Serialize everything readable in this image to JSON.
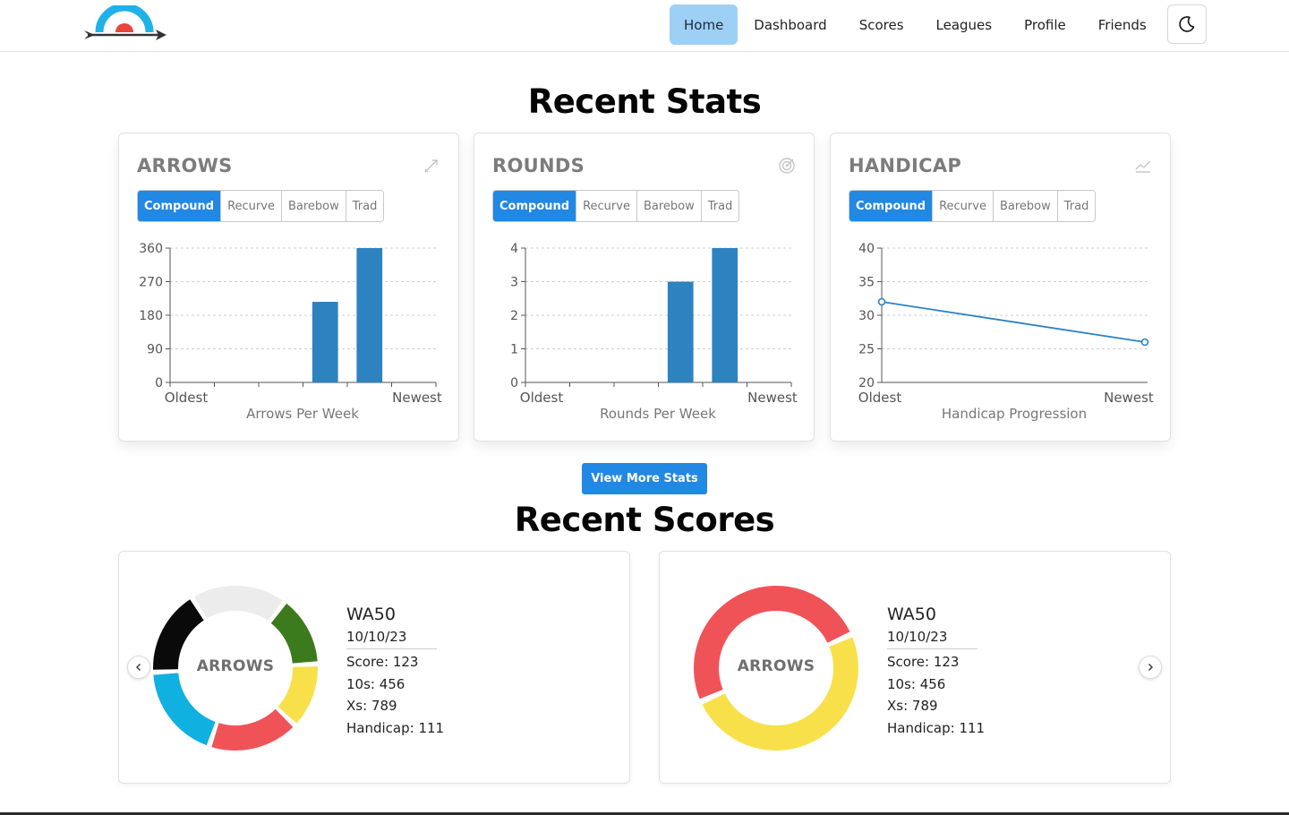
{
  "nav": {
    "items": [
      {
        "label": "Home",
        "active": true
      },
      {
        "label": "Dashboard"
      },
      {
        "label": "Scores"
      },
      {
        "label": "Leagues"
      },
      {
        "label": "Profile"
      },
      {
        "label": "Friends"
      }
    ],
    "theme_icon": "moon-icon",
    "logo_icon": "archery-target-arrow-logo"
  },
  "recent_stats": {
    "title": "Recent Stats",
    "tabs": [
      "Compound",
      "Recurve",
      "Barebow",
      "Trad"
    ],
    "active_tab": "Compound",
    "cards": [
      {
        "title": "ARROWS",
        "icon": "arrow-icon"
      },
      {
        "title": "ROUNDS",
        "icon": "target-icon"
      },
      {
        "title": "HANDICAP",
        "icon": "line-chart-icon"
      }
    ],
    "view_more_label": "View More Stats"
  },
  "chart_data": [
    {
      "type": "bar",
      "categories": [
        "",
        "",
        "",
        "Oldest",
        "Newest",
        ""
      ],
      "x_tick_labels": {
        "left": "Oldest",
        "right": "Newest"
      },
      "values": [
        0,
        0,
        0,
        216,
        360,
        0
      ],
      "xlabel": "Arrows Per Week",
      "ylabel": "",
      "yticks": [
        0,
        90,
        180,
        270,
        360
      ],
      "ylim": [
        0,
        360
      ],
      "grid": true,
      "color": "#2d82c0"
    },
    {
      "type": "bar",
      "categories": [
        "",
        "",
        "",
        "",
        "",
        ""
      ],
      "x_tick_labels": {
        "left": "Oldest",
        "right": "Newest"
      },
      "values": [
        0,
        0,
        0,
        3,
        4,
        0
      ],
      "xlabel": "Rounds Per Week",
      "ylabel": "",
      "yticks": [
        0,
        1,
        2,
        3,
        4
      ],
      "ylim": [
        0,
        4
      ],
      "grid": true,
      "color": "#2d82c0"
    },
    {
      "type": "line",
      "x": [
        "Oldest",
        "Newest"
      ],
      "x_tick_labels": {
        "left": "Oldest",
        "right": "Newest"
      },
      "values": [
        32,
        26
      ],
      "xlabel": "Handicap Progression",
      "ylabel": "",
      "yticks": [
        20,
        25,
        30,
        35,
        40
      ],
      "ylim": [
        20,
        40
      ],
      "grid": true,
      "color": "#2d82c0"
    }
  ],
  "recent_scores": {
    "title": "Recent Scores",
    "cards": [
      {
        "center_label": "ARROWS",
        "round": "WA50",
        "date": "10/10/23",
        "score": "Score: 123",
        "tens": "10s: 456",
        "xs": "Xs: 789",
        "handicap": "Handicap: 111",
        "segments": [
          {
            "color": "#ececec",
            "fraction": 0.19
          },
          {
            "color": "#3c7a1e",
            "fraction": 0.14
          },
          {
            "color": "#f8e04a",
            "fraction": 0.13
          },
          {
            "color": "#f05357",
            "fraction": 0.18
          },
          {
            "color": "#10b0e0",
            "fraction": 0.19
          },
          {
            "color": "#0a0a0a",
            "fraction": 0.17
          }
        ]
      },
      {
        "center_label": "ARROWS",
        "round": "WA50",
        "date": "10/10/23",
        "score": "Score: 123",
        "tens": "10s: 456",
        "xs": "Xs: 789",
        "handicap": "Handicap: 111",
        "segments": [
          {
            "color": "#f8e04a",
            "fraction": 0.5
          },
          {
            "color": "#f05357",
            "fraction": 0.5
          }
        ]
      }
    ],
    "prev_icon": "chevron-left-icon",
    "next_icon": "chevron-right-icon"
  }
}
